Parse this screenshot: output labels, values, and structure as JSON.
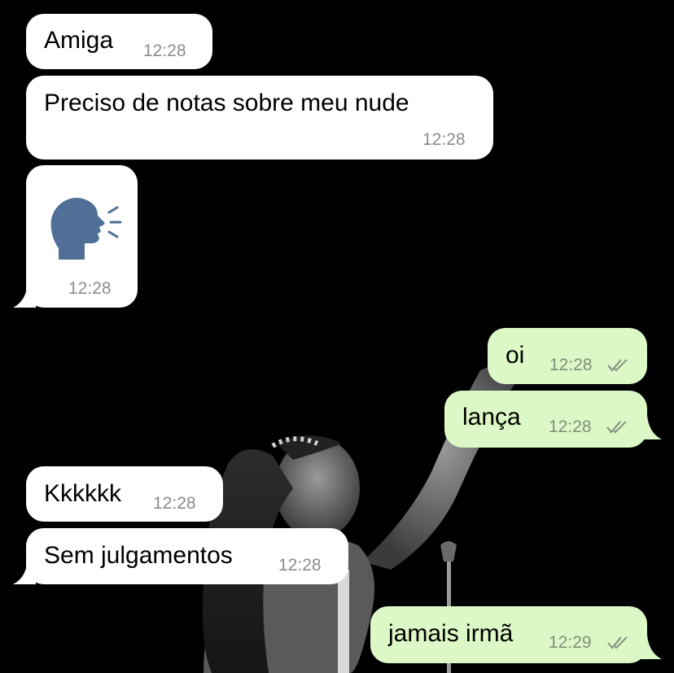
{
  "chat": {
    "messages": [
      {
        "direction": "incoming",
        "text": "Amiga",
        "time": "12:28"
      },
      {
        "direction": "incoming",
        "text": "Preciso de notas sobre meu nude",
        "time": "12:28"
      },
      {
        "direction": "incoming",
        "emoji": "speaking-head-emoji",
        "time": "12:28"
      },
      {
        "direction": "outgoing",
        "text": "oi",
        "time": "12:28",
        "status": "double-check-read"
      },
      {
        "direction": "outgoing",
        "text": "lança",
        "time": "12:28",
        "status": "double-check-read"
      },
      {
        "direction": "incoming",
        "text": "Kkkkkk",
        "time": "12:28"
      },
      {
        "direction": "incoming",
        "text": "Sem julgamentos",
        "time": "12:28"
      },
      {
        "direction": "outgoing",
        "text": "jamais irmã",
        "time": "12:29",
        "status": "double-check-read"
      }
    ]
  },
  "colors": {
    "background": "#000000",
    "incoming_bubble": "#ffffff",
    "outgoing_bubble": "#dcf8c6",
    "timestamp": "#8c8c8c"
  }
}
